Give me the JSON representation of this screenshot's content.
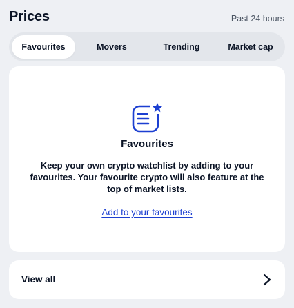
{
  "header": {
    "title": "Prices",
    "period": "Past 24 hours"
  },
  "tabs": [
    {
      "label": "Favourites",
      "active": true
    },
    {
      "label": "Movers",
      "active": false
    },
    {
      "label": "Trending",
      "active": false
    },
    {
      "label": "Market cap",
      "active": false
    }
  ],
  "favourites_card": {
    "icon": "favourites-list-star-icon",
    "title": "Favourites",
    "description": "Keep your own crypto watchlist by adding to your favourites. Your favourite crypto will also feature at the top of market lists.",
    "link_label": "Add to your favourites"
  },
  "view_all": {
    "label": "View all",
    "icon": "chevron-right-icon"
  },
  "colors": {
    "background": "#eef0f4",
    "card": "#ffffff",
    "text": "#0b1426",
    "link": "#1c3fd1",
    "icon_blue": "#1c3fd1"
  }
}
